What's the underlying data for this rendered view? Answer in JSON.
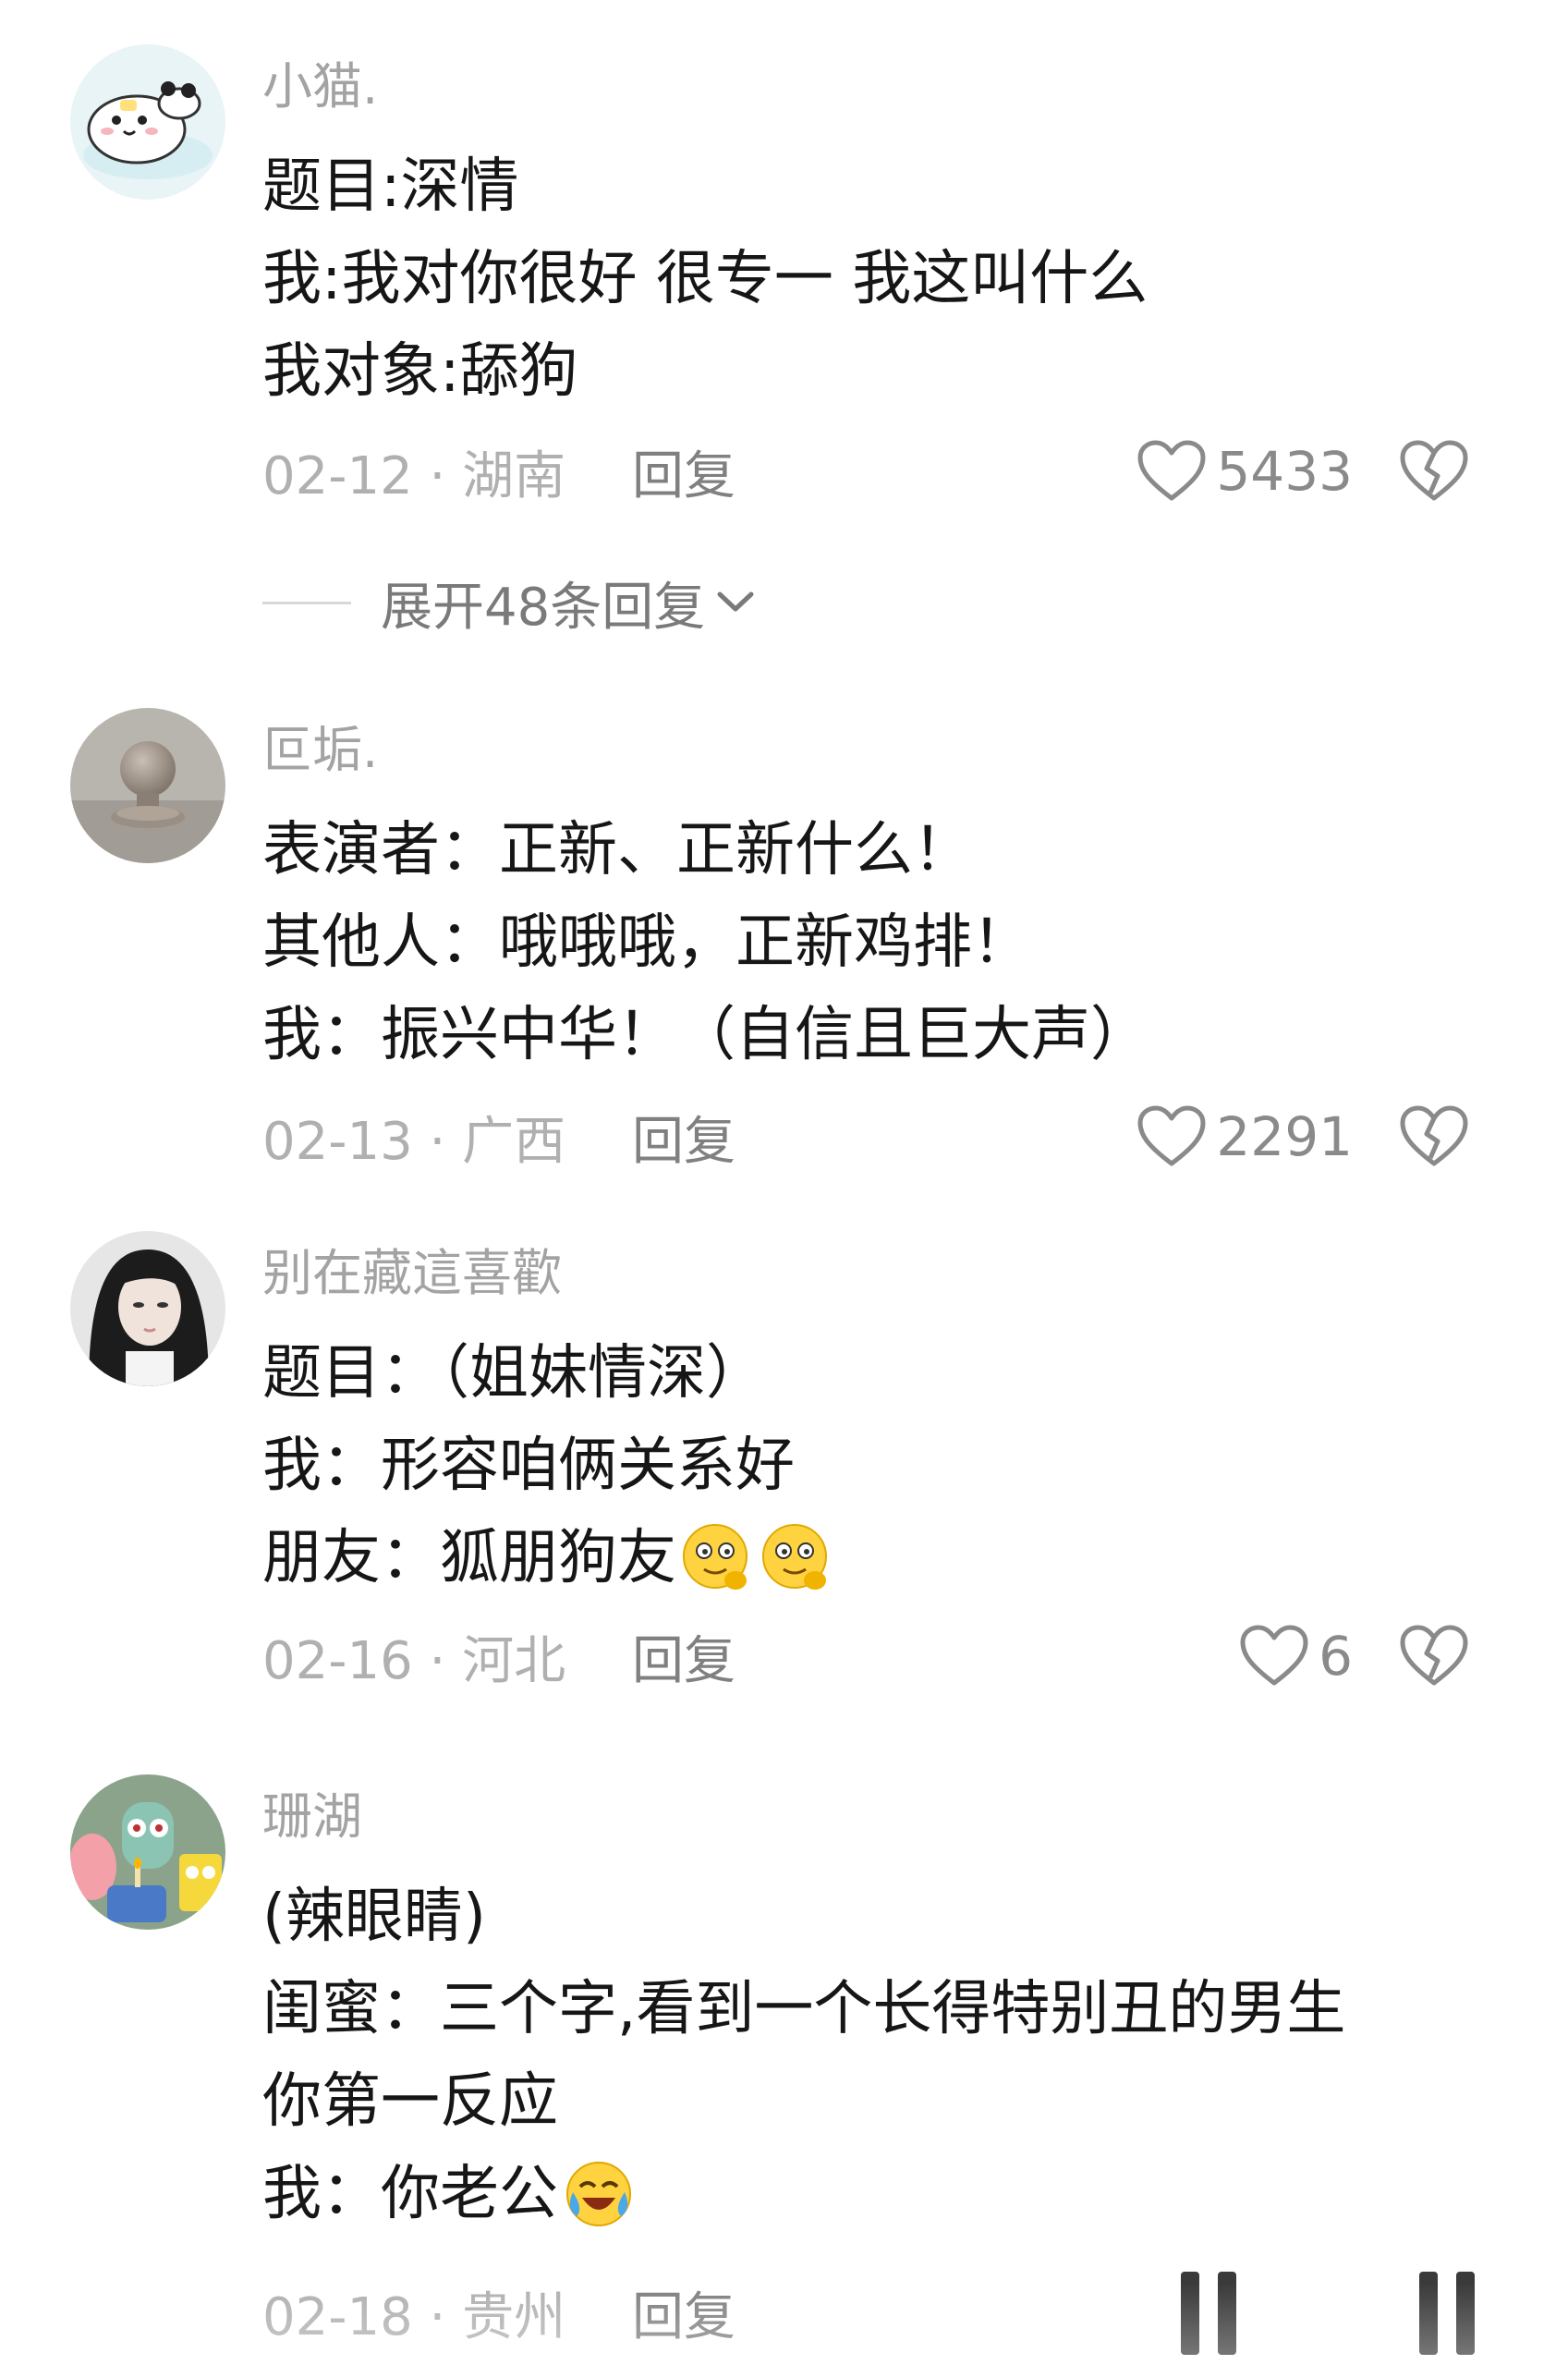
{
  "comments": [
    {
      "username": "小猫.",
      "lines": [
        "题目:深情",
        "我:我对你很好 很专一 我这叫什么",
        "我对象:舔狗"
      ],
      "date_location": "02-12 · 湖南",
      "reply_label": "回复",
      "likes": "5433"
    },
    {
      "username": "叵垢.",
      "lines": [
        "表演者：正新、正新什么！",
        "其他人：哦哦哦，正新鸡排！",
        "我：振兴中华！（自信且巨大声）"
      ],
      "date_location": "02-13 · 广西",
      "reply_label": "回复",
      "likes": "2291"
    },
    {
      "username": "别在藏這喜歡",
      "lines": [
        "题目：（姐妹情深）",
        "我：形容咱俩关系好",
        "朋友：狐朋狗友"
      ],
      "date_location": "02-16 · 河北",
      "reply_label": "回复",
      "likes": "6"
    },
    {
      "username": "珊湖",
      "lines": [
        "(辣眼睛)",
        "闺蜜：三个字,看到一个长得特别丑的男生",
        "你第一反应",
        "我：你老公"
      ],
      "date_location": "02-18 · 贵州",
      "reply_label": "回复",
      "likes": ""
    }
  ],
  "expand_replies": {
    "label": "展开48条回复"
  },
  "icons": {
    "like": "heart-outline-icon",
    "dislike": "broken-heart-icon",
    "expand": "chevron-down-icon",
    "emoji_thinking": "drooling-thinking-emoji",
    "emoji_laugh": "laughing-crying-emoji"
  },
  "colors": {
    "meta_text": "#b0b0b0",
    "username": "#a3a3a3",
    "body_text": "#161616"
  }
}
